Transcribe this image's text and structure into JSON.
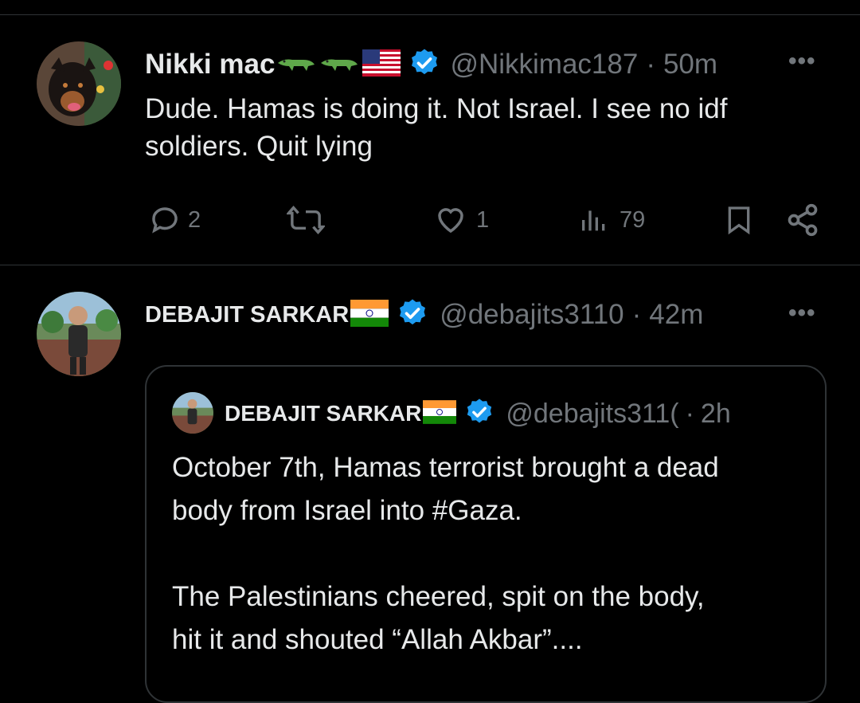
{
  "tweet1": {
    "name": "Nikki mac",
    "handle": "@Nikkimac187",
    "time": "50m",
    "text_line1": "Dude. Hamas is doing it. Not Israel. I see no idf",
    "text_line2": "soldiers. Quit lying",
    "replies": "2",
    "likes": "1",
    "views": "79",
    "emoji": [
      "crocodile-emoji",
      "crocodile-emoji",
      "us-flag"
    ],
    "more": "•••"
  },
  "tweet2": {
    "name": "DEBAJIT SARKAR",
    "handle": "@debajits3110",
    "time": "42m",
    "flag": "india-flag",
    "more": "•••"
  },
  "quote": {
    "name": "DEBAJIT SARKAR",
    "handle": "@debajits311(",
    "time": "2h",
    "line1": "October 7th, Hamas terrorist brought a dead",
    "line2": "body from Israel into #Gaza.",
    "line3": "The Palestinians cheered, spit on the body,",
    "line4": "hit it and shouted “Allah Akbar”...."
  },
  "sep": "·",
  "colors": {
    "verified": "#1d9bf0",
    "muted": "#71767b",
    "text": "#e7e9ea",
    "divider": "#2f3336"
  }
}
